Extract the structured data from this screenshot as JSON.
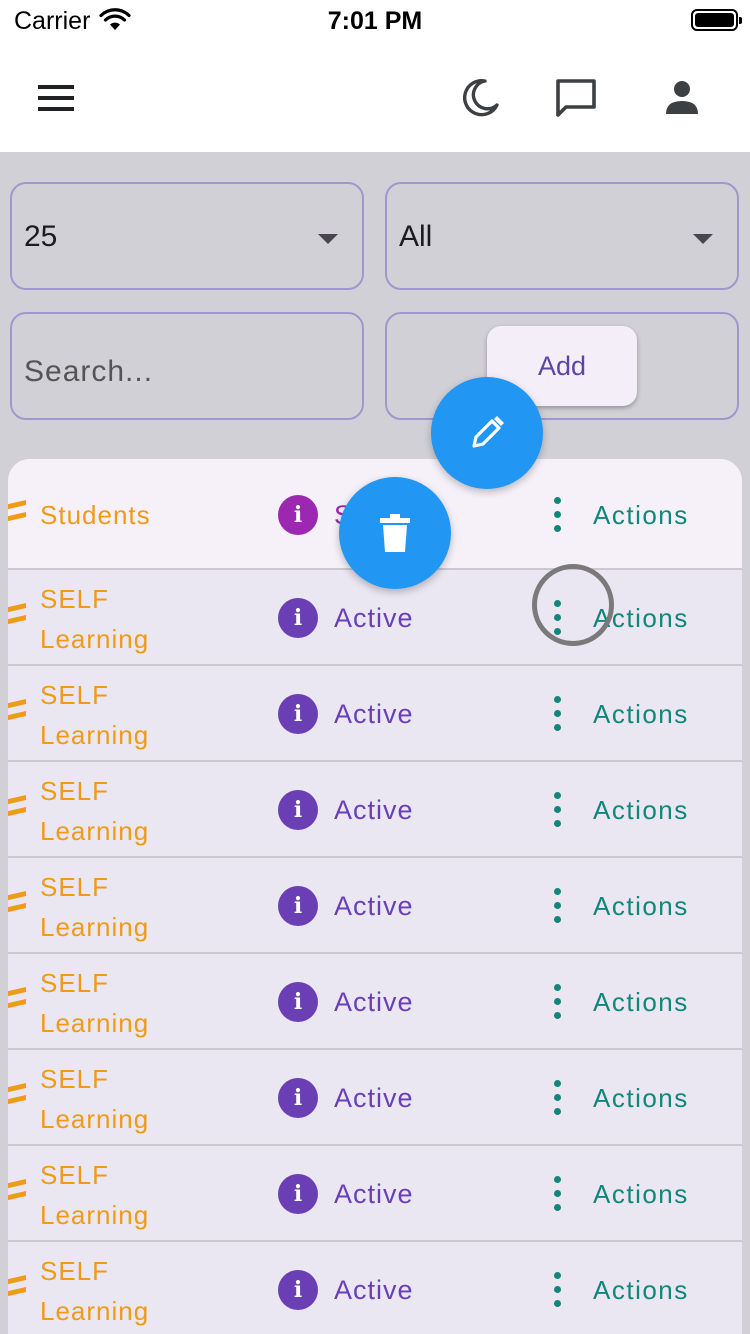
{
  "status_bar": {
    "carrier": "Carrier",
    "time": "7:01 PM"
  },
  "app_bar": {
    "menu_icon": "hamburger-menu-icon",
    "theme_icon": "moon-icon",
    "chat_icon": "chat-bubble-icon",
    "profile_icon": "person-icon"
  },
  "filters": {
    "page_size": {
      "selected": "25"
    },
    "status_filter": {
      "selected": "All"
    },
    "search": {
      "placeholder": "Search...",
      "value": ""
    },
    "add_label": "Add"
  },
  "table": {
    "header": {
      "name": "Students",
      "status": "S",
      "actions": "Actions"
    },
    "rows": [
      {
        "line1": "SELF",
        "line2": "Learning",
        "status": "Active",
        "actions": "Actions"
      },
      {
        "line1": "SELF",
        "line2": "Learning",
        "status": "Active",
        "actions": "Actions"
      },
      {
        "line1": "SELF",
        "line2": "Learning",
        "status": "Active",
        "actions": "Actions"
      },
      {
        "line1": "SELF",
        "line2": "Learning",
        "status": "Active",
        "actions": "Actions"
      },
      {
        "line1": "SELF",
        "line2": "Learning",
        "status": "Active",
        "actions": "Actions"
      },
      {
        "line1": "SELF",
        "line2": "Learning",
        "status": "Active",
        "actions": "Actions"
      },
      {
        "line1": "SELF",
        "line2": "Learning",
        "status": "Active",
        "actions": "Actions"
      },
      {
        "line1": "SELF",
        "line2": "Learning",
        "status": "Active",
        "actions": "Actions"
      }
    ]
  },
  "fab_menu": {
    "edit_icon": "pencil-icon",
    "delete_icon": "trash-icon"
  },
  "colors": {
    "accent_orange": "#f19a16",
    "accent_purple": "#6a3fb6",
    "accent_teal": "#10877a",
    "fab_blue": "#2196f3",
    "header_info_magenta": "#9c27b0"
  }
}
